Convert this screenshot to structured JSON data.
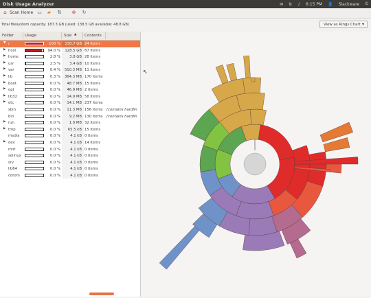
{
  "window": {
    "title": "Disk Usage Analyzer"
  },
  "tray": {
    "mail_icon": "mail-icon",
    "net_icon": "network-icon",
    "vol_icon": "volume-icon",
    "time": "6:15 PM",
    "user": "Slackware",
    "power_icon": "power-icon"
  },
  "toolbar": {
    "scan_home": "Scan Home",
    "icons": [
      "home-icon",
      "scan-device-icon",
      "open-folder-icon",
      "rescan-icon",
      "stop-icon",
      "refresh-icon"
    ]
  },
  "capacity": {
    "text": "Total filesystem capacity: 187.3 GB (used: 138.5 GB available: 48.8 GB)"
  },
  "view_combo": {
    "label": "View as Rings Chart"
  },
  "table": {
    "headers": {
      "folder": "Folder",
      "usage": "Usage",
      "size": "Size",
      "contents": "Contents"
    },
    "rows": [
      {
        "expander": "▼",
        "name": "/",
        "pct": "100 %",
        "usage": 1.0,
        "size": "130.7 GB",
        "contents": "24 items",
        "note": "",
        "selected": true
      },
      {
        "expander": "▶",
        "name": "host",
        "pct": "94.0 %",
        "usage": 0.94,
        "size": "128.5 GB",
        "contents": "67 items",
        "note": ""
      },
      {
        "expander": "▶",
        "name": "home",
        "pct": "2.8 %",
        "usage": 0.028,
        "size": "3.8 GB",
        "contents": "28 items",
        "note": ""
      },
      {
        "expander": "▶",
        "name": "usr",
        "pct": "2.5 %",
        "usage": 0.025,
        "size": "3.4 GB",
        "contents": "10 items",
        "note": ""
      },
      {
        "expander": "▶",
        "name": "var",
        "pct": "0.4 %",
        "usage": 0.004,
        "size": "510.3 MB",
        "contents": "11 items",
        "note": ""
      },
      {
        "expander": "▶",
        "name": "lib",
        "pct": "0.3 %",
        "usage": 0.003,
        "size": "364.3 MB",
        "contents": "170 items",
        "note": ""
      },
      {
        "expander": "▶",
        "name": "boot",
        "pct": "0.0 %",
        "usage": 0.0,
        "size": "48.7 MB",
        "contents": "15 items",
        "note": ""
      },
      {
        "expander": "▶",
        "name": "opt",
        "pct": "0.0 %",
        "usage": 0.0,
        "size": "46.9 MB",
        "contents": "2 items",
        "note": ""
      },
      {
        "expander": "▶",
        "name": "lib32",
        "pct": "0.0 %",
        "usage": 0.0,
        "size": "14.9 MB",
        "contents": "58 items",
        "note": ""
      },
      {
        "expander": "▶",
        "name": "etc",
        "pct": "0.0 %",
        "usage": 0.0,
        "size": "14.1 MB",
        "contents": "237 items",
        "note": ""
      },
      {
        "expander": "",
        "name": "sbin",
        "pct": "0.0 %",
        "usage": 0.0,
        "size": "11.3 MB",
        "contents": "156 items",
        "note": "(contains hardlin"
      },
      {
        "expander": "",
        "name": "bin",
        "pct": "0.0 %",
        "usage": 0.0,
        "size": "9.2 MB",
        "contents": "130 items",
        "note": "(contains hardlin"
      },
      {
        "expander": "▶",
        "name": "run",
        "pct": "0.0 %",
        "usage": 0.0,
        "size": "1.0 MB",
        "contents": "32 items",
        "note": ""
      },
      {
        "expander": "▶",
        "name": "tmp",
        "pct": "0.0 %",
        "usage": 0.0,
        "size": "65.5 kB",
        "contents": "15 items",
        "note": ""
      },
      {
        "expander": "",
        "name": "media",
        "pct": "0.0 %",
        "usage": 0.0,
        "size": "4.1 kB",
        "contents": "0 items",
        "note": ""
      },
      {
        "expander": "▶",
        "name": "dev",
        "pct": "0.0 %",
        "usage": 0.0,
        "size": "4.1 kB",
        "contents": "14 items",
        "note": ""
      },
      {
        "expander": "",
        "name": "mnt",
        "pct": "0.0 %",
        "usage": 0.0,
        "size": "4.1 kB",
        "contents": "0 items",
        "note": ""
      },
      {
        "expander": "",
        "name": "selinux",
        "pct": "0.0 %",
        "usage": 0.0,
        "size": "4.1 kB",
        "contents": "0 items",
        "note": ""
      },
      {
        "expander": "",
        "name": "srv",
        "pct": "0.0 %",
        "usage": 0.0,
        "size": "4.1 kB",
        "contents": "0 items",
        "note": ""
      },
      {
        "expander": "",
        "name": "lib64",
        "pct": "0.0 %",
        "usage": 0.0,
        "size": "4.1 kB",
        "contents": "0 items",
        "note": ""
      },
      {
        "expander": "",
        "name": "cdrom",
        "pct": "0.0 %",
        "usage": 0.0,
        "size": "4.1 kB",
        "contents": "0 items",
        "note": ""
      }
    ]
  },
  "rings": {
    "colors": {
      "red": "#e02b2b",
      "redLight": "#e8583f",
      "orange": "#e57a35",
      "yellow": "#d7a84a",
      "green": "#82c341",
      "greenDark": "#5ca551",
      "blue": "#6f93c8",
      "purple": "#9a7bb8",
      "pink": "#b56a90",
      "center": "#d6d6d6"
    }
  }
}
